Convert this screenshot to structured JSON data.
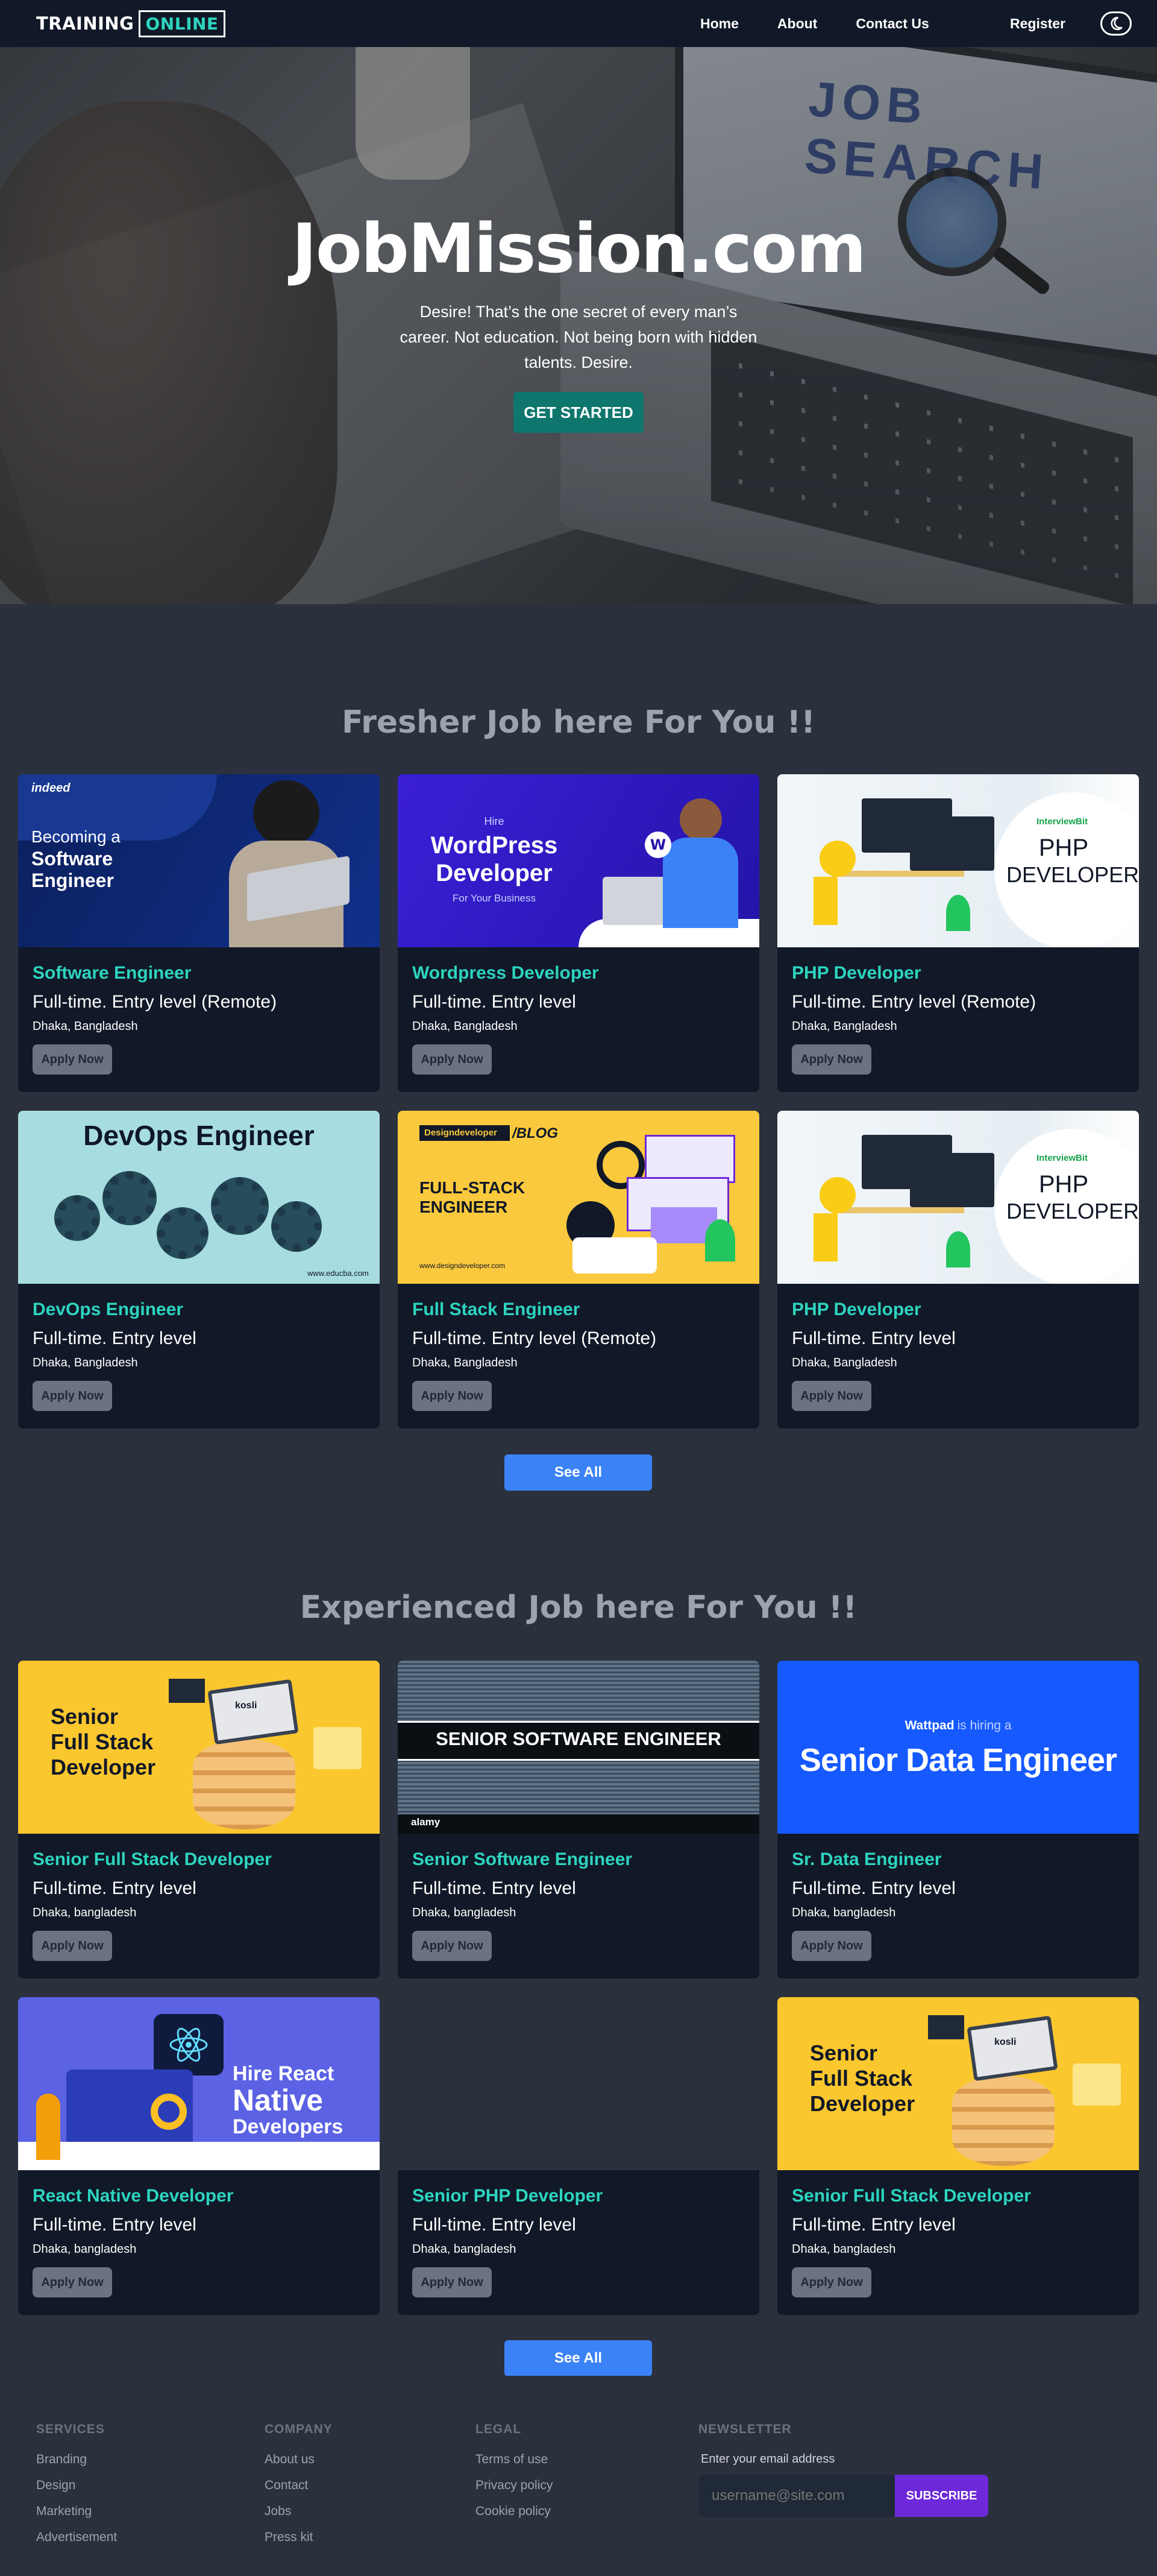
{
  "navbar": {
    "brand_primary": "TRAINING",
    "brand_secondary": "ONLINE",
    "links": [
      "Home",
      "About",
      "Contact Us"
    ],
    "register_label": "Register",
    "theme_icon": "moon-icon"
  },
  "hero": {
    "title": "JobMission.com",
    "subtitle": "Desire! That’s the one secret of every man’s career. Not education. Not being born with hidden talents. Desire.",
    "cta_label": "GET STARTED",
    "screen_text": "JOB SEARCH"
  },
  "fresher": {
    "title": "Fresher Job here For You !!",
    "see_all_label": "See All",
    "jobs": [
      {
        "title": "Software Engineer",
        "type": "Full-time. Entry level (Remote)",
        "location": "Dhaka, Bangladesh",
        "apply_label": "Apply Now",
        "image_text": [
          "indeed",
          "Becoming a",
          "Software",
          "Engineer"
        ]
      },
      {
        "title": "Wordpress Developer",
        "type": "Full-time. Entry level",
        "location": "Dhaka, Bangladesh",
        "apply_label": "Apply Now",
        "image_text": [
          "Hire",
          "WordPress",
          "Developer",
          "For Your Business"
        ]
      },
      {
        "title": "PHP Developer",
        "type": "Full-time. Entry level (Remote)",
        "location": "Dhaka, Bangladesh",
        "apply_label": "Apply Now",
        "image_text": [
          "InterviewBit",
          "PHP",
          "DEVELOPER"
        ]
      },
      {
        "title": "DevOps Engineer",
        "type": "Full-time. Entry level",
        "location": "Dhaka, Bangladesh",
        "apply_label": "Apply Now",
        "image_text": [
          "DevOps Engineer",
          "www.educba.com"
        ]
      },
      {
        "title": "Full Stack Engineer",
        "type": "Full-time. Entry level (Remote)",
        "location": "Dhaka, Bangladesh",
        "apply_label": "Apply Now",
        "image_text": [
          "Designdeveloper",
          "/BLOG",
          "FULL-STACK",
          "ENGINEER",
          "www.designdeveloper.com"
        ]
      },
      {
        "title": "PHP Developer",
        "type": "Full-time. Entry level",
        "location": "Dhaka, Bangladesh",
        "apply_label": "Apply Now",
        "image_text": [
          "InterviewBit",
          "PHP",
          "DEVELOPER"
        ]
      }
    ]
  },
  "experienced": {
    "title": "Experienced Job here For You !!",
    "see_all_label": "See All",
    "jobs": [
      {
        "title": "Senior Full Stack Developer",
        "type": "Full-time. Entry level",
        "location": "Dhaka, bangladesh",
        "apply_label": "Apply Now",
        "image_text": [
          "Senior",
          "Full Stack",
          "Developer",
          "kosli"
        ]
      },
      {
        "title": "Senior Software Engineer",
        "type": "Full-time. Entry level",
        "location": "Dhaka, bangladesh",
        "apply_label": "Apply Now",
        "image_text": [
          "SENIOR SOFTWARE ENGINEER",
          "alamy"
        ]
      },
      {
        "title": "Sr. Data Engineer",
        "type": "Full-time. Entry level",
        "location": "Dhaka, bangladesh",
        "apply_label": "Apply Now",
        "image_text": [
          "Wattpad",
          "is hiring a",
          "Senior Data Engineer"
        ]
      },
      {
        "title": "React Native Developer",
        "type": "Full-time. Entry level",
        "location": "Dhaka, bangladesh",
        "apply_label": "Apply Now",
        "image_text": [
          "Hire React",
          "Native",
          "Developers"
        ]
      },
      {
        "title": "Senior PHP Developer",
        "type": "Full-time. Entry level",
        "location": "Dhaka, bangladesh",
        "apply_label": "Apply Now",
        "image_text": []
      },
      {
        "title": "Senior Full Stack Developer",
        "type": "Full-time. Entry level",
        "location": "Dhaka, bangladesh",
        "apply_label": "Apply Now",
        "image_text": [
          "Senior",
          "Full Stack",
          "Developer",
          "kosli"
        ]
      }
    ]
  },
  "footer": {
    "services": {
      "heading": "SERVICES",
      "links": [
        "Branding",
        "Design",
        "Marketing",
        "Advertisement"
      ]
    },
    "company": {
      "heading": "COMPANY",
      "links": [
        "About us",
        "Contact",
        "Jobs",
        "Press kit"
      ]
    },
    "legal": {
      "heading": "LEGAL",
      "links": [
        "Terms of use",
        "Privacy policy",
        "Cookie policy"
      ]
    },
    "newsletter": {
      "heading": "NEWSLETTER",
      "label": "Enter your email address",
      "placeholder": "username@site.com",
      "button_label": "SUBSCRIBE"
    }
  }
}
